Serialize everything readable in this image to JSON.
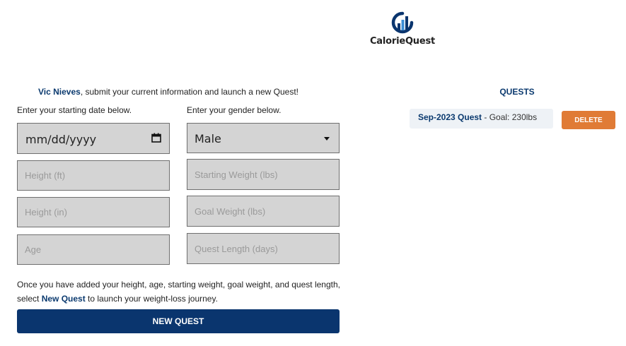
{
  "brand": {
    "name": "CalorieQuest",
    "logo_icon": "bar-chart-circle-icon",
    "colors": {
      "navy": "#0a356e",
      "light_blue": "#3b8ed6"
    }
  },
  "intro": {
    "user_name": "Vic Nieves",
    "text": ", submit your current information and launch a new Quest!"
  },
  "form": {
    "date_hint": "Enter your starting date below.",
    "gender_hint": "Enter your gender below.",
    "date_value": "mm/dd/yyyy",
    "gender_value": "Male",
    "height_ft_placeholder": "Height (ft)",
    "height_in_placeholder": "Height (in)",
    "age_placeholder": "Age",
    "start_weight_placeholder": "Starting Weight (lbs)",
    "goal_weight_placeholder": "Goal Weight (lbs)",
    "quest_length_placeholder": "Quest Length (days)"
  },
  "instructions": {
    "before": "Once you have added your height, age, starting weight, goal weight, and quest length, select ",
    "highlight": "New Quest",
    "after": " to launch your weight-loss journey."
  },
  "new_quest_label": "NEW QUEST",
  "quests": {
    "heading": "QUESTS",
    "items": [
      {
        "name": "Sep-2023 Quest",
        "detail": " - Goal: 230lbs",
        "delete_label": "DELETE"
      }
    ]
  },
  "colors": {
    "field_bg": "#d4d4d4",
    "button_primary": "#0a356e",
    "button_delete": "#e07b36",
    "quest_item_bg": "#eef2f6"
  }
}
